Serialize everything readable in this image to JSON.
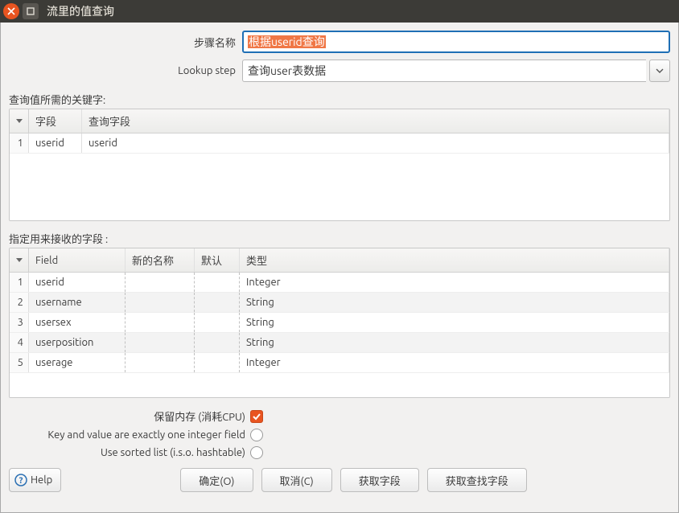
{
  "window": {
    "title": "流里的值查询"
  },
  "form": {
    "step_name_label": "步骤名称",
    "step_name_value": "根据userid查询",
    "lookup_step_label": "Lookup step",
    "lookup_step_value": "查询user表数据"
  },
  "keys_section_label": "查询值所需的关键字:",
  "keys_columns": {
    "field": "字段",
    "lookup_field": "查询字段"
  },
  "keys_rows": [
    {
      "num": "1",
      "field": "userid",
      "lookup_field": "userid"
    }
  ],
  "fields_section_label": "指定用来接收的字段 :",
  "fields_columns": {
    "field": "Field",
    "new_name": "新的名称",
    "default": "默认",
    "type": "类型"
  },
  "fields_rows": [
    {
      "num": "1",
      "field": "userid",
      "new_name": "",
      "default": "",
      "type": "Integer"
    },
    {
      "num": "2",
      "field": "username",
      "new_name": "",
      "default": "",
      "type": "String"
    },
    {
      "num": "3",
      "field": "usersex",
      "new_name": "",
      "default": "",
      "type": "String"
    },
    {
      "num": "4",
      "field": "userposition",
      "new_name": "",
      "default": "",
      "type": "String"
    },
    {
      "num": "5",
      "field": "userage",
      "new_name": "",
      "default": "",
      "type": "Integer"
    }
  ],
  "options": {
    "preserve_memory_label": "保留内存 (消耗CPU)",
    "one_integer_label": "Key and value are exactly one integer field",
    "sorted_list_label": "Use sorted list (i.s.o. hashtable)",
    "preserve_memory_checked": true,
    "one_integer_checked": false,
    "sorted_list_checked": false
  },
  "buttons": {
    "help": "Help",
    "ok": "确定(O)",
    "cancel": "取消(C)",
    "get_fields": "获取字段",
    "get_lookup_fields": "获取查找字段"
  }
}
